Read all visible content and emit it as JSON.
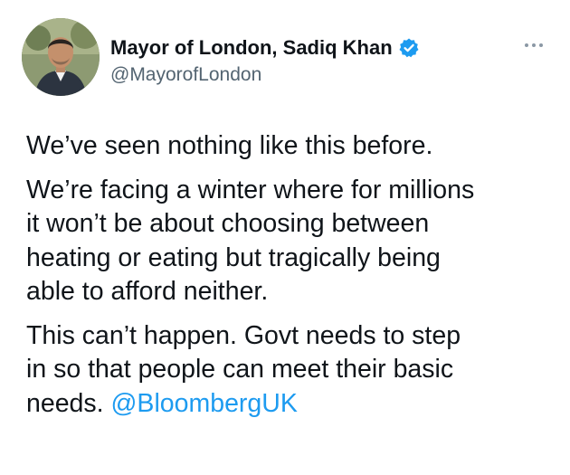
{
  "author": {
    "display_name": "Mayor of London, Sadiq Khan",
    "handle": "@MayorofLondon",
    "verified": true,
    "avatar_icon": "profile-photo"
  },
  "tweet": {
    "paragraph_1": "We’ve seen nothing like this before.",
    "paragraph_2_lines": [
      "We’re facing a winter where for millions",
      "it won’t be about choosing between",
      "heating or eating but tragically being",
      "able to afford neither."
    ],
    "paragraph_3_lines": [
      "This can’t happen. Govt needs to step",
      "in so that people can meet their basic"
    ],
    "paragraph_3_last": "needs.",
    "mention": "@BloombergUK"
  },
  "colors": {
    "text": "#0f1419",
    "secondary": "#536471",
    "link": "#1d9bf0",
    "verified": "#1d9bf0"
  },
  "icons": {
    "verified": "verified-badge-icon",
    "more": "more-options-icon"
  }
}
